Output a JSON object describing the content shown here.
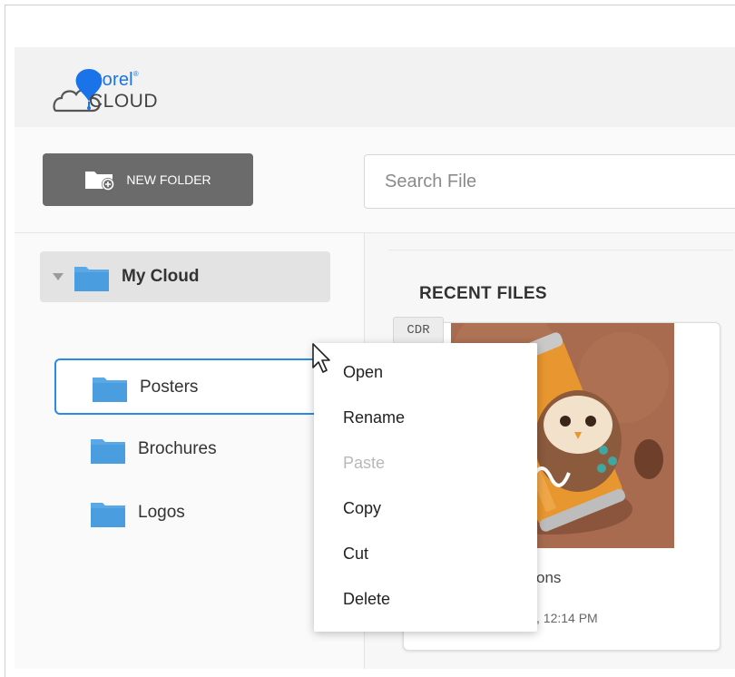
{
  "brand": {
    "name_line1": "Corel",
    "trademark": "®",
    "name_line2": "CLOUD",
    "accent_color": "#1a73e8"
  },
  "toolbar": {
    "new_folder_label": "NEW FOLDER",
    "new_folder_icon": "folder-plus-icon",
    "search_placeholder": "Search File"
  },
  "sidebar": {
    "root": {
      "label": "My Cloud",
      "expanded": true
    },
    "items": [
      {
        "label": "Posters",
        "selected": true
      },
      {
        "label": "Brochures",
        "selected": false
      },
      {
        "label": "Logos",
        "selected": false
      }
    ],
    "folder_color": "#5aa9e6"
  },
  "main": {
    "section_title": "RECENT FILES",
    "files": [
      {
        "badge": "CDR",
        "name_visible": "ons",
        "date_visible": ", 12:14 PM"
      }
    ]
  },
  "context_menu": {
    "items": [
      {
        "label": "Open",
        "disabled": false
      },
      {
        "label": "Rename",
        "disabled": false
      },
      {
        "label": "Paste",
        "disabled": true
      },
      {
        "label": "Copy",
        "disabled": false
      },
      {
        "label": "Cut",
        "disabled": false
      },
      {
        "label": "Delete",
        "disabled": false
      }
    ]
  }
}
